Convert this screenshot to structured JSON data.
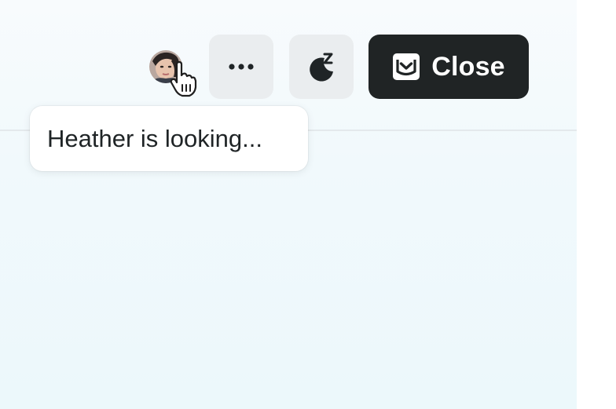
{
  "header": {
    "viewer": {
      "avatar_icon": "user-avatar",
      "cursor_icon": "hand-pointer-icon"
    },
    "actions": {
      "more_icon": "ellipsis-icon",
      "snooze_icon": "moon-snooze-icon",
      "close_icon": "inbox-close-icon",
      "close_label": "Close"
    }
  },
  "presence_tooltip": {
    "text": "Heather is looking..."
  },
  "colors": {
    "close_button_bg": "#202425",
    "icon_button_bg": "#eaedef",
    "panel_bg": "#f1f9fc"
  }
}
